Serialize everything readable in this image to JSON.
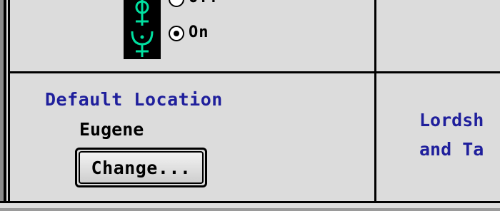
{
  "radio_group": {
    "options": [
      {
        "label": "Off",
        "selected": false
      },
      {
        "label": "On",
        "selected": true
      }
    ]
  },
  "default_location": {
    "title": "Default Location",
    "name": "Eugene",
    "change_button": "Change..."
  },
  "right_panel": {
    "line1": "Lordsh",
    "line2": "and Ta"
  },
  "colors": {
    "heading": "#1f1f9c",
    "background": "#dcdcdc",
    "icon_glyph": "#00e0a0"
  },
  "icons": [
    "astrology-glyph-icon"
  ]
}
